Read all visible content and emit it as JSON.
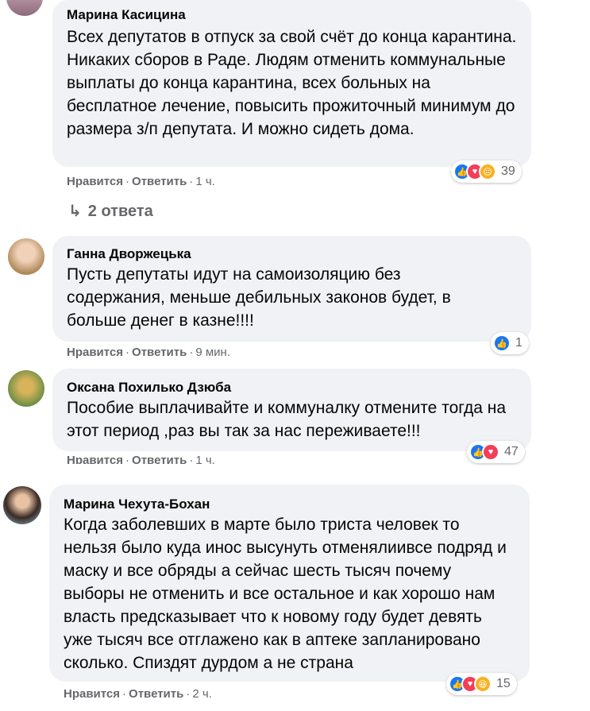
{
  "actions": {
    "like": "Нравится",
    "reply": "Ответить",
    "sep": "·"
  },
  "comments": [
    {
      "author": "Марина Касицина",
      "text": "Всех депутатов в отпуск за свой счёт до конца карантина. Никаких сборов в Раде. Людям отменить коммунальные выплаты до конца карантина, всех больных на бесплатное лечение, повысить прожиточный минимум до размера з/п депутата. И можно сидеть дома.",
      "time": "1 ч.",
      "reactions": [
        "like",
        "love",
        "sad"
      ],
      "reaction_count": "39",
      "replies": "2 ответа"
    },
    {
      "author": "Ганна Дворжецька",
      "text": "Пусть депутаты идут на самоизоляцию без содержания, меньше дебильных законов будет, в больше денег в казне!!!!",
      "time": "9 мин.",
      "reactions": [
        "like"
      ],
      "reaction_count": "1"
    },
    {
      "author": "Оксана Похилько Дзюба",
      "text": "Пособие выплачивайте и коммуналку отмените тогда на этот период ,раз вы так за нас переживаете!!!",
      "time": "1 ч.",
      "reactions": [
        "like",
        "love"
      ],
      "reaction_count": "47"
    },
    {
      "author": "Марина Чехута-Бохан",
      "text": "Когда заболевших в марте было триста человек то нельзя было куда инос высунуть отменялиивсе подряд и маску и все обряды а сейчас шесть тысяч почему выборы не отменить и все остальное и как хорошо нам власть предсказывает что к новому году будет девять уже тысяч все отглажено как в аптеке запланировано сколько. Спиздят дурдом а не страна",
      "time": "2 ч.",
      "reactions": [
        "like",
        "love",
        "haha"
      ],
      "reaction_count": "15"
    }
  ]
}
